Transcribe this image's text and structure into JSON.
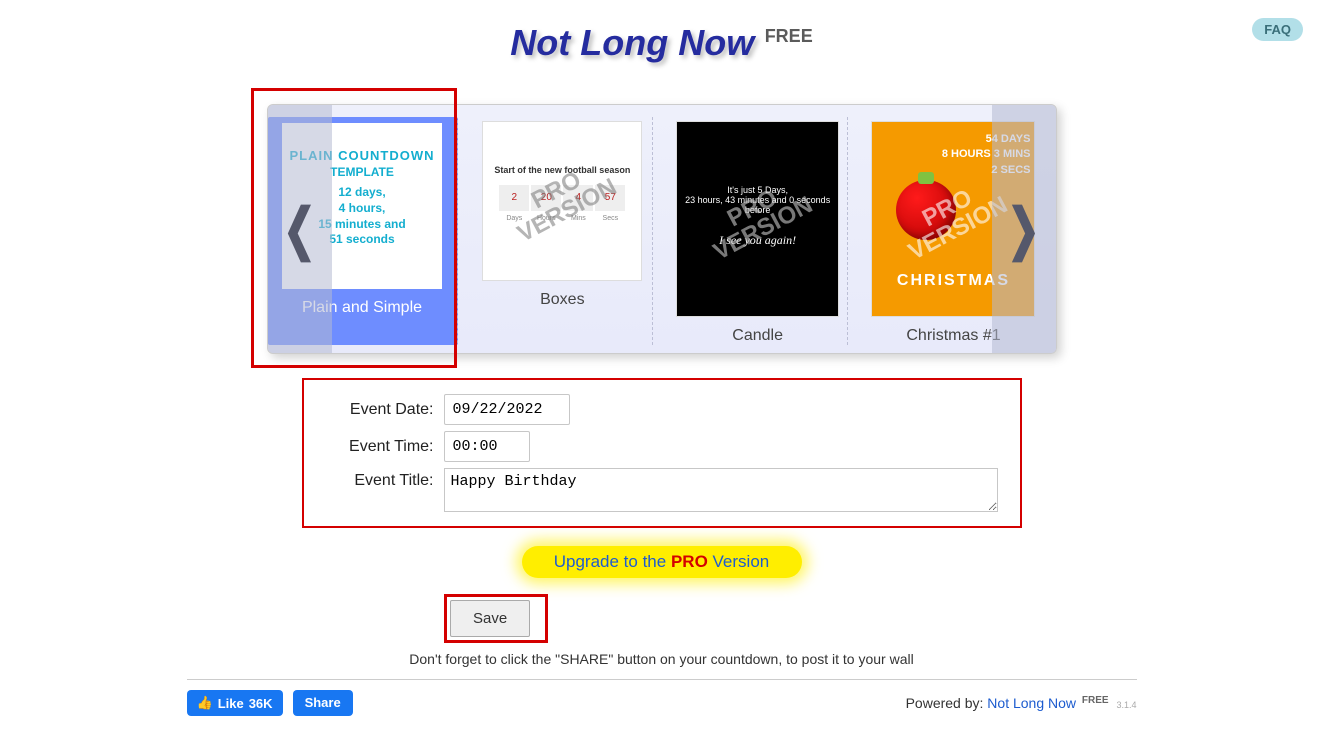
{
  "faq": {
    "label": "FAQ"
  },
  "header": {
    "title": "Not Long Now",
    "suffix": "FREE"
  },
  "carousel": {
    "templates": [
      {
        "name": "Plain and Simple",
        "watermark": "",
        "selected": true
      },
      {
        "name": "Boxes",
        "watermark": "PRO\nVERSION"
      },
      {
        "name": "Candle",
        "watermark": "PRO\nVERSION"
      },
      {
        "name": "Christmas #1",
        "watermark": "PRO\nVERSION"
      }
    ],
    "plain_thumb": {
      "title": "PLAIN COUNTDOWN",
      "subtitle": "TEMPLATE",
      "body": "12 days,\n4 hours,\n15 minutes and\n51 seconds"
    },
    "boxes_thumb": {
      "head": "Start of the new football season",
      "vals": [
        "2",
        "20",
        "4",
        "57"
      ],
      "labels": [
        "Days",
        "Hours",
        "Mins",
        "Secs"
      ]
    },
    "candle_thumb": {
      "line1": "It's just 5 Days,",
      "line2": "23 hours, 43 minutes and 0 seconds before",
      "see": "I see you again!"
    },
    "xmas_thumb": {
      "big": "54 DAYS\n8 HOURS 3 MINS\n2 SECS",
      "label": "CHRISTMAS"
    }
  },
  "form": {
    "date_label": "Event Date:",
    "date_value": "09/22/2022",
    "time_label": "Event Time:",
    "time_value": "00:00",
    "title_label": "Event Title:",
    "title_value": "Happy Birthday"
  },
  "upgrade": {
    "pre": "Upgrade to the ",
    "pro": "PRO",
    "post": " Version"
  },
  "save": {
    "label": "Save"
  },
  "hint": "Don't forget to click the \"SHARE\" button on your countdown, to post it to your wall",
  "footer": {
    "like_label": "Like",
    "like_count": "36K",
    "share_label": "Share",
    "powered_pre": "Powered by: ",
    "powered_link": "Not Long Now",
    "powered_suffix": "FREE",
    "version": "3.1.4"
  }
}
